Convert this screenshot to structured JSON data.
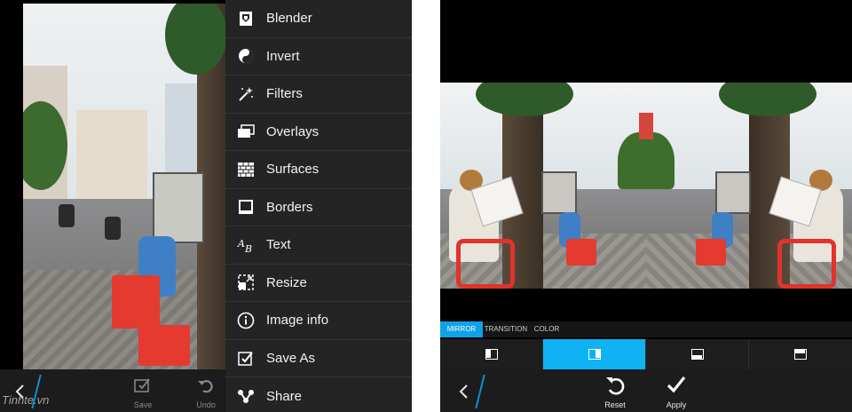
{
  "left": {
    "menu_items": [
      {
        "label": "Blender",
        "icon": "blender-icon"
      },
      {
        "label": "Invert",
        "icon": "invert-icon"
      },
      {
        "label": "Filters",
        "icon": "magic-wand-icon"
      },
      {
        "label": "Overlays",
        "icon": "overlays-icon"
      },
      {
        "label": "Surfaces",
        "icon": "brick-surface-icon"
      },
      {
        "label": "Borders",
        "icon": "border-frame-icon"
      },
      {
        "label": "Text",
        "icon": "text-ab-icon"
      },
      {
        "label": "Resize",
        "icon": "resize-icon"
      },
      {
        "label": "Image info",
        "icon": "info-icon"
      },
      {
        "label": "Save As",
        "icon": "save-as-icon"
      },
      {
        "label": "Share",
        "icon": "share-icon"
      }
    ],
    "toolbar": {
      "save_label": "Save",
      "undo_label": "Undo"
    },
    "watermark": "Tinhte.vn"
  },
  "right": {
    "tabs": [
      {
        "label": "MIRROR",
        "active": true
      },
      {
        "label": "TRANSITION",
        "active": false
      },
      {
        "label": "COLOR",
        "active": false
      }
    ],
    "modes": [
      {
        "icon": "mirror-left-icon",
        "active": false
      },
      {
        "icon": "mirror-right-icon",
        "active": true
      },
      {
        "icon": "mirror-top-icon",
        "active": false
      },
      {
        "icon": "mirror-bottom-icon",
        "active": false
      }
    ],
    "toolbar": {
      "reset_label": "Reset",
      "apply_label": "Apply"
    }
  },
  "colors": {
    "accent": "#0fb2f3",
    "menu_bg": "#242424",
    "toolbar_bg": "#1c1c1c"
  }
}
